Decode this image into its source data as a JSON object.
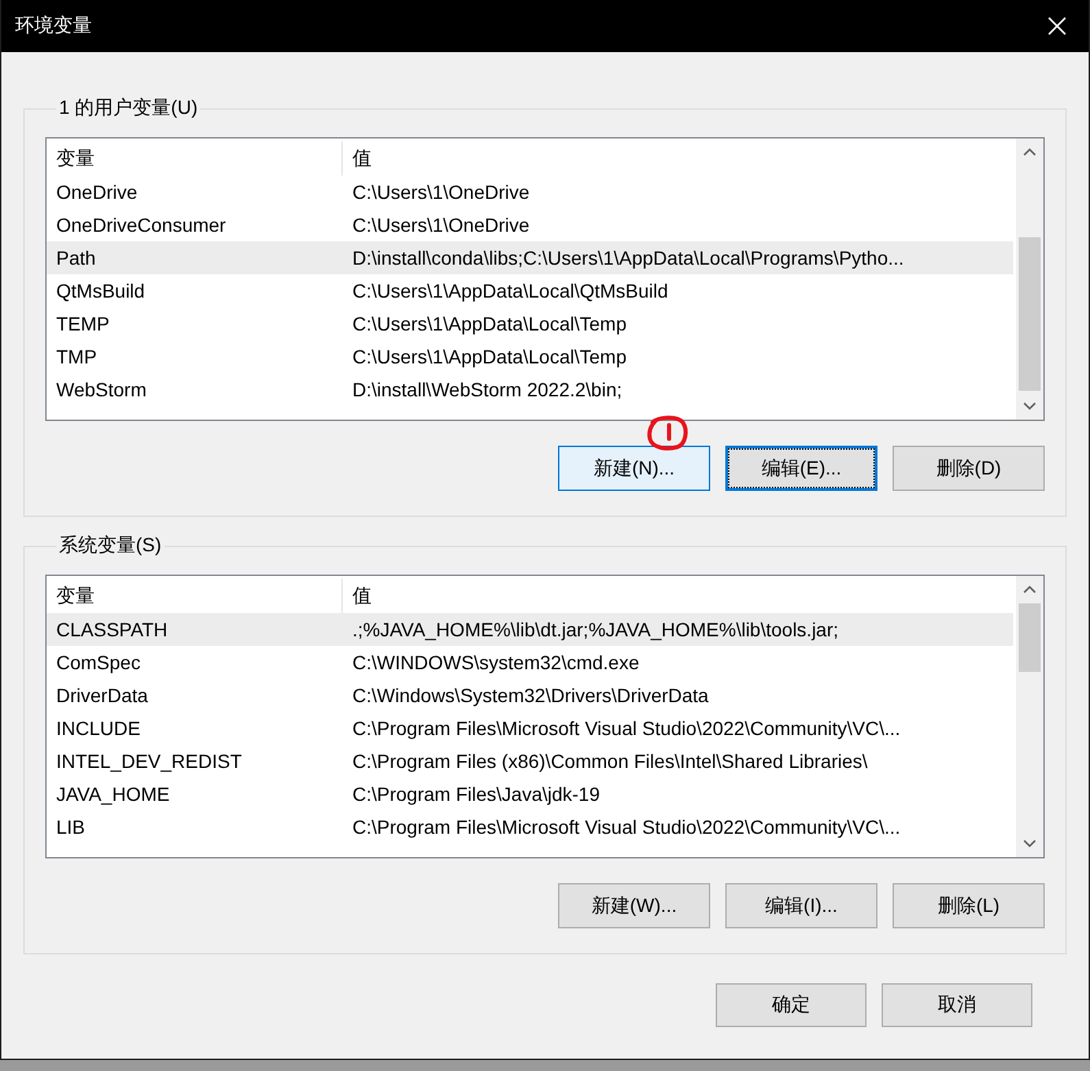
{
  "window": {
    "title": "环境变量"
  },
  "user_variables": {
    "legend": "1 的用户变量(U)",
    "columns": [
      "变量",
      "值"
    ],
    "rows": [
      {
        "name": "OneDrive",
        "value": "C:\\Users\\1\\OneDrive",
        "selected": false
      },
      {
        "name": "OneDriveConsumer",
        "value": "C:\\Users\\1\\OneDrive",
        "selected": false
      },
      {
        "name": "Path",
        "value": "D:\\install\\conda\\libs;C:\\Users\\1\\AppData\\Local\\Programs\\Pytho...",
        "selected": true
      },
      {
        "name": "QtMsBuild",
        "value": "C:\\Users\\1\\AppData\\Local\\QtMsBuild",
        "selected": false
      },
      {
        "name": "TEMP",
        "value": "C:\\Users\\1\\AppData\\Local\\Temp",
        "selected": false
      },
      {
        "name": "TMP",
        "value": "C:\\Users\\1\\AppData\\Local\\Temp",
        "selected": false
      },
      {
        "name": "WebStorm",
        "value": "D:\\install\\WebStorm 2022.2\\bin;",
        "selected": false
      }
    ],
    "buttons": [
      {
        "label": "新建(N)...",
        "hovered": true,
        "focused": false
      },
      {
        "label": "编辑(E)...",
        "hovered": false,
        "focused": true
      },
      {
        "label": "删除(D)",
        "hovered": false,
        "focused": false
      }
    ]
  },
  "system_variables": {
    "legend": "系统变量(S)",
    "columns": [
      "变量",
      "值"
    ],
    "rows": [
      {
        "name": "CLASSPATH",
        "value": ".;%JAVA_HOME%\\lib\\dt.jar;%JAVA_HOME%\\lib\\tools.jar;",
        "selected": true
      },
      {
        "name": "ComSpec",
        "value": "C:\\WINDOWS\\system32\\cmd.exe",
        "selected": false
      },
      {
        "name": "DriverData",
        "value": "C:\\Windows\\System32\\Drivers\\DriverData",
        "selected": false
      },
      {
        "name": "INCLUDE",
        "value": "C:\\Program Files\\Microsoft Visual Studio\\2022\\Community\\VC\\...",
        "selected": false
      },
      {
        "name": "INTEL_DEV_REDIST",
        "value": "C:\\Program Files (x86)\\Common Files\\Intel\\Shared Libraries\\",
        "selected": false
      },
      {
        "name": "JAVA_HOME",
        "value": "C:\\Program Files\\Java\\jdk-19",
        "selected": false
      },
      {
        "name": "LIB",
        "value": "C:\\Program Files\\Microsoft Visual Studio\\2022\\Community\\VC\\...",
        "selected": false
      }
    ],
    "buttons": [
      {
        "label": "新建(W)...",
        "hovered": false,
        "focused": false
      },
      {
        "label": "编辑(I)...",
        "hovered": false,
        "focused": false
      },
      {
        "label": "删除(L)",
        "hovered": false,
        "focused": false
      }
    ]
  },
  "footer_buttons": [
    {
      "label": "确定",
      "hovered": false,
      "focused": false
    },
    {
      "label": "取消",
      "hovered": false,
      "focused": false
    }
  ]
}
